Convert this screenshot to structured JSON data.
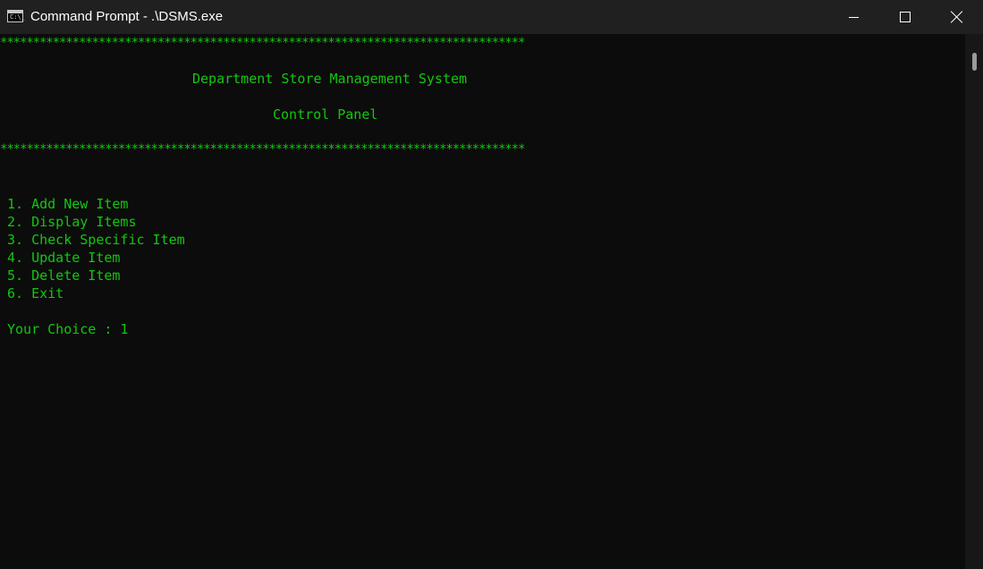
{
  "window": {
    "title": "Command Prompt - .\\DSMS.exe",
    "icon": "cmd-icon",
    "icon_text": "C:\\_",
    "controls": [
      "minimize-icon",
      "maximize-icon",
      "close-icon"
    ]
  },
  "console": {
    "text_color": "#13c70f",
    "background": "#0c0c0c",
    "border_stars": "********************************************************************************",
    "title": "Department Store Management System",
    "subtitle": "Control Panel",
    "menu": [
      "1. Add New Item",
      "2. Display Items",
      "3. Check Specific Item",
      "4. Update Item",
      "5. Delete Item",
      "6. Exit"
    ],
    "prompt": "Your Choice : 1"
  }
}
